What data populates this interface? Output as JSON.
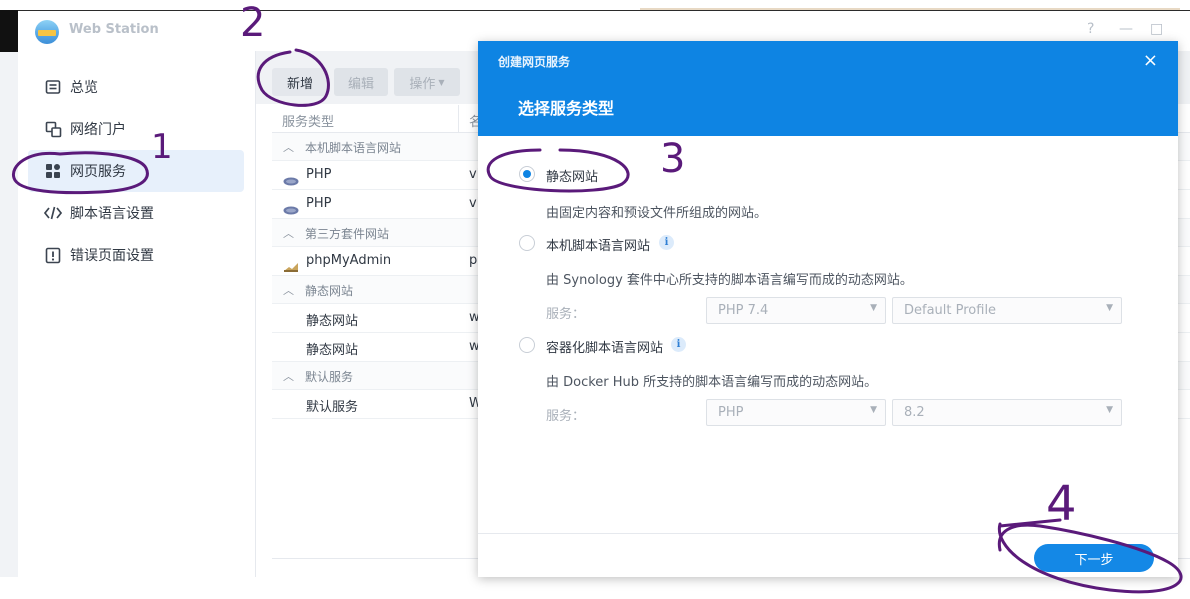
{
  "app": {
    "title": "Web Station",
    "help_glyph": "?",
    "minimize_glyph": "—",
    "maximize_glyph": "□"
  },
  "sidebar": {
    "items": [
      {
        "label": "总览",
        "icon": "overview-icon"
      },
      {
        "label": "网络门户",
        "icon": "portal-icon"
      },
      {
        "label": "网页服务",
        "icon": "web-service-icon",
        "active": true
      },
      {
        "label": "脚本语言设置",
        "icon": "code-icon"
      },
      {
        "label": "错误页面设置",
        "icon": "error-page-icon"
      }
    ]
  },
  "toolbar": {
    "add_label": "新增",
    "edit_label": "编辑",
    "action_label": "操作"
  },
  "grid": {
    "col_type": "服务类型",
    "col_name": "名",
    "groups": [
      {
        "label": "本机脚本语言网站",
        "rows": [
          {
            "type": "PHP",
            "name": "vl"
          },
          {
            "type": "PHP",
            "name": "vl"
          }
        ]
      },
      {
        "label": "第三方套件网站",
        "rows": [
          {
            "type": "phpMyAdmin",
            "name": "pl"
          }
        ]
      },
      {
        "label": "静态网站",
        "rows": [
          {
            "type": "静态网站",
            "name": "w"
          },
          {
            "type": "静态网站",
            "name": "w"
          }
        ]
      },
      {
        "label": "默认服务",
        "rows": [
          {
            "type": "默认服务",
            "name": "W"
          }
        ]
      }
    ]
  },
  "dialog": {
    "header_small": "创建网页服务",
    "close_glyph": "×",
    "title": "选择服务类型",
    "options": [
      {
        "label": "静态网站",
        "desc": "由固定内容和预设文件所组成的网站。",
        "checked": true
      },
      {
        "label": "本机脚本语言网站",
        "desc": "由 Synology 套件中心所支持的脚本语言编写而成的动态网站。",
        "service_label": "服务：",
        "select1": "PHP 7.4",
        "select2": "Default Profile"
      },
      {
        "label": "容器化脚本语言网站",
        "desc": "由 Docker Hub 所支持的脚本语言编写而成的动态网站。",
        "service_label": "服务：",
        "select1": "PHP",
        "select2": "8.2"
      }
    ],
    "info_glyph": "i",
    "next_label": "下一步"
  },
  "annotations": {
    "marks": [
      "1",
      "2",
      "3",
      "4"
    ],
    "color": "#5a1a7a"
  },
  "colors": {
    "accent": "#0e84e3",
    "sidebar_active": "#e7f0fb",
    "annotation_ink": "#5a1a7a"
  }
}
